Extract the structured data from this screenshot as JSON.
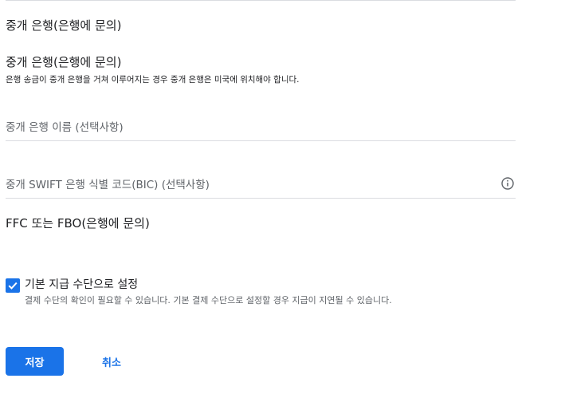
{
  "colors": {
    "accent": "#1a73e8",
    "text": "#202124",
    "secondary_text": "#5f6368",
    "divider": "#dadce0"
  },
  "form": {
    "intermediary_bank_heading": "중개 은행(은행에 문의)",
    "intermediary_bank_heading_2": "중개 은행(은행에 문의)",
    "intermediary_help": "은행 송금이 중개 은행을 거쳐 이루어지는 경우 중개 은행은 미국에 위치해야 합니다.",
    "bank_name_placeholder": "중개 은행 이름 (선택사항)",
    "swift_placeholder": "중개 SWIFT 은행 식별 코드(BIC) (선택사항)",
    "swift_info_icon": "info-icon",
    "ffc_heading": "FFC 또는 FBO(은행에 문의)"
  },
  "default_payment": {
    "checked": true,
    "label": "기본 지급 수단으로 설정",
    "help": "결제 수단의 확인이 필요할 수 있습니다. 기본 결제 수단으로 설정할 경우 지급이 지연될 수 있습니다."
  },
  "actions": {
    "save_label": "저장",
    "cancel_label": "취소"
  }
}
